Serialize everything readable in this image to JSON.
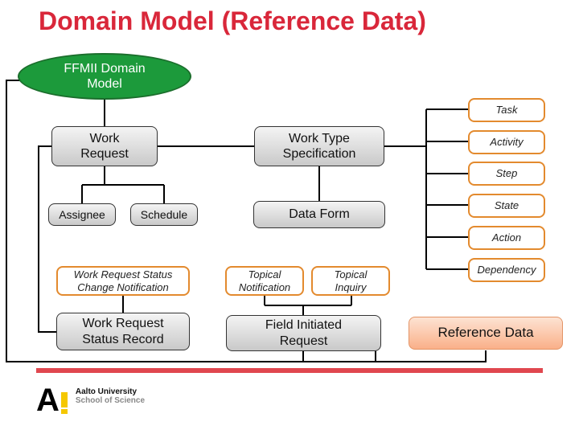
{
  "title": "Domain Model (Reference Data)",
  "nodes": {
    "root": "FFMII Domain Model",
    "work_request": "Work Request",
    "work_type_specification": "Work Type Specification",
    "assignee": "Assignee",
    "schedule": "Schedule",
    "data_form": "Data Form",
    "task": "Task",
    "activity": "Activity",
    "step": "Step",
    "state": "State",
    "action": "Action",
    "dependency": "Dependency",
    "wr_status_change_notification": "Work Request Status Change Notification",
    "wr_status_record": "Work Request Status Record",
    "topical_notification": "Topical Notification",
    "topical_inquiry": "Topical Inquiry",
    "field_initiated_request": "Field Initiated Request",
    "reference_data": "Reference Data"
  },
  "colors": {
    "title": "#d9273a",
    "root_fill": "#1c9a3b",
    "orange_border": "#e38a2e",
    "reference_fill": "#fab089",
    "divider": "#e0474f",
    "logo_accent": "#f5c800"
  },
  "footer": {
    "logo_letter": "A",
    "org_line1": "Aalto University",
    "org_line2": "School of Science"
  }
}
